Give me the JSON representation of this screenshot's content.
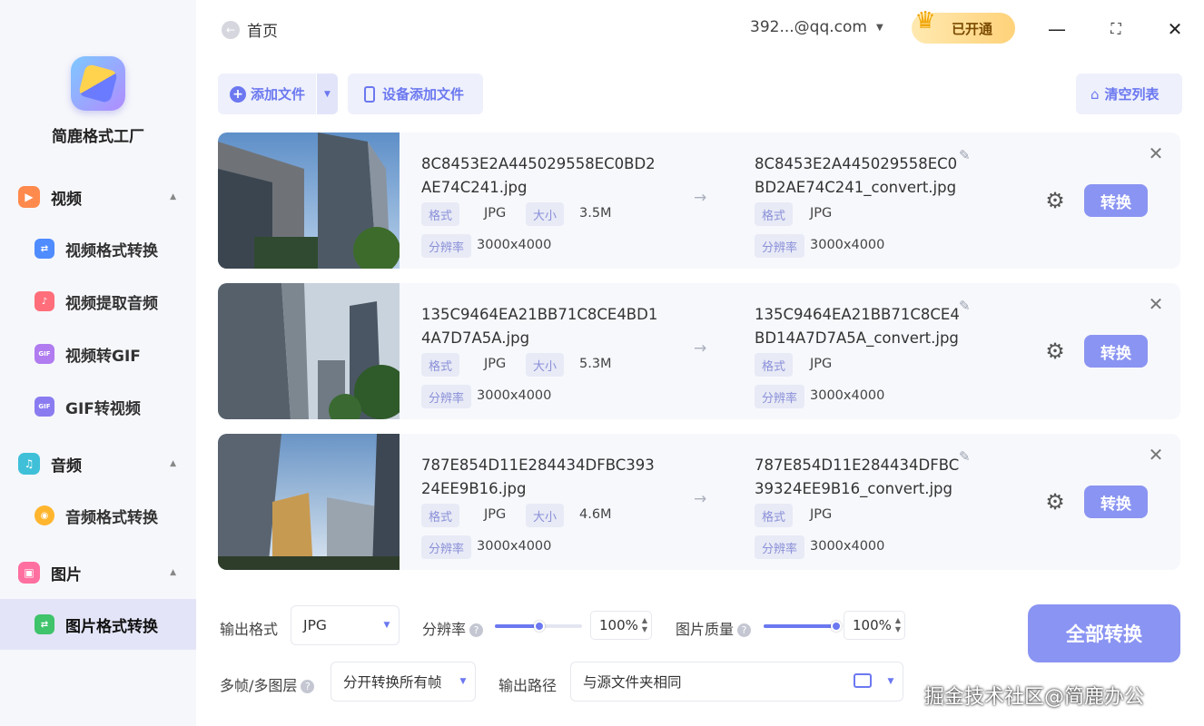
{
  "app": {
    "name": "简鹿格式工厂"
  },
  "sidebar": {
    "groups": [
      {
        "label": "视频",
        "icon": "video-icon",
        "color": "#ff8a4d"
      },
      {
        "label": "音频",
        "icon": "music-icon",
        "color": "#3fc0d8"
      },
      {
        "label": "图片",
        "icon": "image-icon",
        "color": "#ff6fa0"
      }
    ],
    "items": [
      {
        "label": "视频格式转换",
        "icon": "video-convert-icon",
        "color": "#4f8cff",
        "glyph": "⇄"
      },
      {
        "label": "视频提取音频",
        "icon": "extract-audio-icon",
        "color": "#ff6e7a",
        "glyph": "♪"
      },
      {
        "label": "视频转GIF",
        "icon": "video-to-gif-icon",
        "color": "#b07cf0",
        "glyph": "GIF"
      },
      {
        "label": "GIF转视频",
        "icon": "gif-to-video-icon",
        "color": "#8a7cf0",
        "glyph": "GIF"
      },
      {
        "label": "音频格式转换",
        "icon": "audio-convert-icon",
        "color": "#ffb52e",
        "glyph": "◉"
      },
      {
        "label": "图片格式转换",
        "icon": "image-convert-icon",
        "color": "#3fc36b",
        "glyph": "⇄"
      }
    ]
  },
  "topbar": {
    "back_label": "首页",
    "account": "392...@qq.com",
    "vip_badge": "VIP",
    "vip_label": "已开通"
  },
  "toolbar": {
    "add_file": "添加文件",
    "device_add": "设备添加文件",
    "clear_list": "清空列表"
  },
  "tags": {
    "format": "格式",
    "size": "大小",
    "resolution": "分辨率"
  },
  "files": [
    {
      "src_name": "8C8453E2A445029558EC0BD2AE74C241.jpg",
      "src_format": "JPG",
      "src_size": "3.5M",
      "src_resolution": "3000x4000",
      "dst_name": "8C8453E2A445029558EC0BD2AE74C241_convert.jpg",
      "dst_format": "JPG",
      "dst_resolution": "3000x4000",
      "convert_label": "转换"
    },
    {
      "src_name": "135C9464EA21BB71C8CE4BD14A7D7A5A.jpg",
      "src_format": "JPG",
      "src_size": "5.3M",
      "src_resolution": "3000x4000",
      "dst_name": "135C9464EA21BB71C8CE4BD14A7D7A5A_convert.jpg",
      "dst_format": "JPG",
      "dst_resolution": "3000x4000",
      "convert_label": "转换"
    },
    {
      "src_name": "787E854D11E284434DFBC39324EE9B16.jpg",
      "src_format": "JPG",
      "src_size": "4.6M",
      "src_resolution": "3000x4000",
      "dst_name": "787E854D11E284434DFBC39324EE9B16_convert.jpg",
      "dst_format": "JPG",
      "dst_resolution": "3000x4000",
      "convert_label": "转换"
    }
  ],
  "settings": {
    "output_format_label": "输出格式",
    "output_format_value": "JPG",
    "resolution_label": "分辨率",
    "resolution_value": "100%",
    "quality_label": "图片质量",
    "quality_value": "100%",
    "multiframe_label": "多帧/多图层",
    "multiframe_value": "分开转换所有帧",
    "output_path_label": "输出路径",
    "output_path_value": "与源文件夹相同",
    "convert_all": "全部转换"
  },
  "watermark": "掘金技术社区@简鹿办公",
  "colors": {
    "accent": "#6b78f0",
    "button": "#8a94f2",
    "sidebar_bg": "#f6f7fb",
    "active_bg": "#e3e4f7"
  }
}
